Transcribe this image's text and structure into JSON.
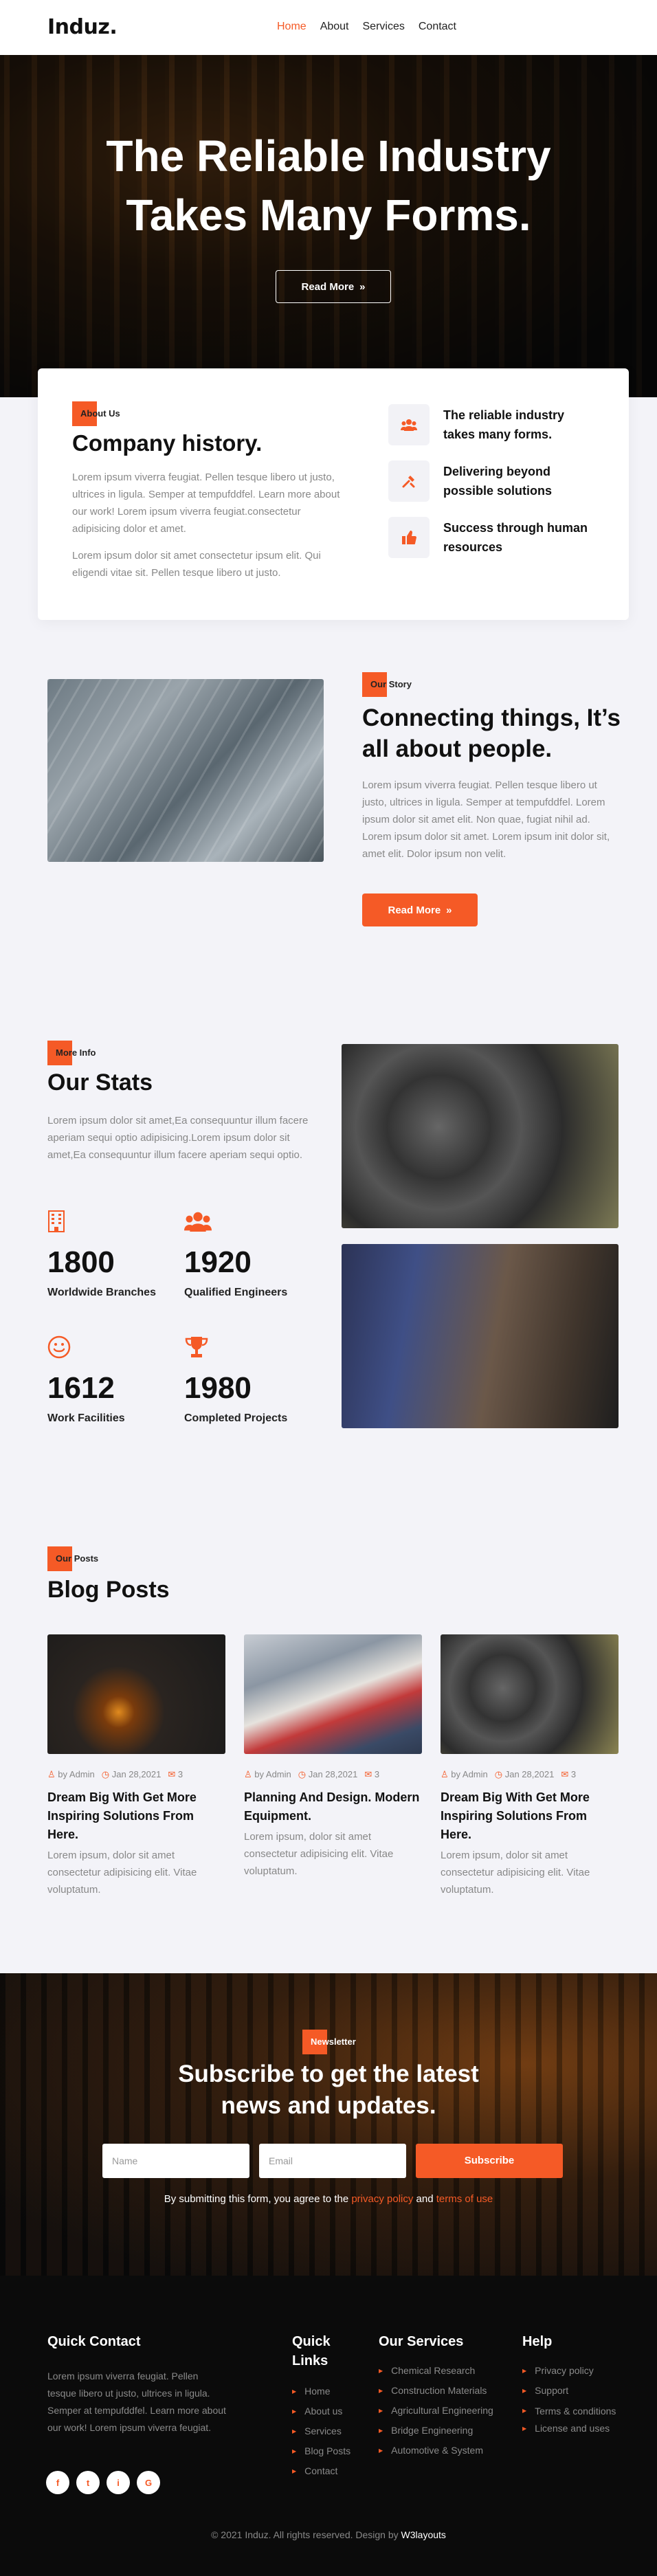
{
  "header": {
    "logo": "Induz.",
    "nav": [
      "Home",
      "About",
      "Services",
      "Contact"
    ]
  },
  "hero": {
    "title_line1": "The Reliable Industry",
    "title_line2": "Takes Many Forms.",
    "button": "Read More"
  },
  "company": {
    "tag": "About Us",
    "title": "Company history.",
    "p1": "Lorem ipsum viverra feugiat. Pellen tesque libero ut justo, ultrices in ligula. Semper at tempufddfel. Learn more about our work! Lorem ipsum viverra feugiat.consectetur adipisicing dolor et amet.",
    "p2": "Lorem ipsum dolor sit amet consectetur ipsum elit. Qui eligendi vitae sit. Pellen tesque libero ut justo.",
    "features": [
      {
        "icon": "users-icon",
        "text": "The reliable industry takes many forms."
      },
      {
        "icon": "tools-icon",
        "text": "Delivering beyond possible solutions"
      },
      {
        "icon": "thumbs-up-icon",
        "text": "Success through human resources"
      }
    ]
  },
  "story": {
    "tag": "Our Story",
    "title": "Connecting things, It’s all about people.",
    "p": "Lorem ipsum viverra feugiat. Pellen tesque libero ut justo, ultrices in ligula. Semper at tempufddfel. Lorem ipsum dolor sit amet elit. Non quae, fugiat nihil ad. Lorem ipsum dolor sit amet. Lorem ipsum init dolor sit, amet elit. Dolor ipsum non velit.",
    "button": "Read More"
  },
  "stats": {
    "tag": "More Info",
    "title": "Our Stats",
    "p": "Lorem ipsum dolor sit amet,Ea consequuntur illum facere aperiam sequi optio adipisicing.Lorem ipsum dolor sit amet,Ea consequuntur illum facere aperiam sequi optio.",
    "items": [
      {
        "icon": "building-icon",
        "value": "1800",
        "label": "Worldwide Branches"
      },
      {
        "icon": "users-icon",
        "value": "1920",
        "label": "Qualified Engineers"
      },
      {
        "icon": "smile-icon",
        "value": "1612",
        "label": "Work Facilities"
      },
      {
        "icon": "trophy-icon",
        "value": "1980",
        "label": "Completed Projects"
      }
    ]
  },
  "blog": {
    "tag": "Our Posts",
    "title": "Blog Posts",
    "posts": [
      {
        "author": "by Admin",
        "date": "Jan 28,2021",
        "comments": "3",
        "title": "Dream Big With Get More Inspiring Solutions From Here.",
        "desc": "Lorem ipsum, dolor sit amet consectetur adipisicing elit. Vitae voluptatum."
      },
      {
        "author": "by Admin",
        "date": "Jan 28,2021",
        "comments": "3",
        "title": "Planning And Design. Modern Equipment.",
        "desc": "Lorem ipsum, dolor sit amet consectetur adipisicing elit. Vitae voluptatum."
      },
      {
        "author": "by Admin",
        "date": "Jan 28,2021",
        "comments": "3",
        "title": "Dream Big With Get More Inspiring Solutions From Here.",
        "desc": "Lorem ipsum, dolor sit amet consectetur adipisicing elit. Vitae voluptatum."
      }
    ]
  },
  "newsletter": {
    "tag": "Newsletter",
    "title_line1": "Subscribe to get the latest",
    "title_line2": "news and updates.",
    "name_placeholder": "Name",
    "email_placeholder": "Email",
    "button": "Subscribe",
    "note_prefix": "By submitting this form, you agree to the",
    "privacy": "privacy policy",
    "and": "and",
    "terms": "terms of use"
  },
  "footer": {
    "contact_title": "Quick Contact",
    "contact_text": "Lorem ipsum viverra feugiat. Pellen tesque libero ut justo, ultrices in ligula. Semper at tempufddfel. Learn more about our work! Lorem ipsum viverra feugiat.",
    "social": [
      "f",
      "t",
      "i",
      "G"
    ],
    "links_title_line1": "Quick",
    "links_title_line2": "Links",
    "links": [
      "Home",
      "About us",
      "Services",
      "Blog Posts",
      "Contact"
    ],
    "services_title": "Our Services",
    "services": [
      "Chemical Research",
      "Construction Materials",
      "Agricultural Engineering",
      "Bridge Engineering",
      "Automotive & System"
    ],
    "help_title": "Help",
    "help": [
      "Privacy policy",
      "Support",
      "Terms & conditions",
      "License and uses"
    ],
    "copyright": "© 2021 Induz. All rights reserved. Design by",
    "designer": "W3layouts"
  },
  "colors": {
    "accent": "#f55a26",
    "dark": "#0b0b0b",
    "light_bg": "#f3f3f8"
  }
}
